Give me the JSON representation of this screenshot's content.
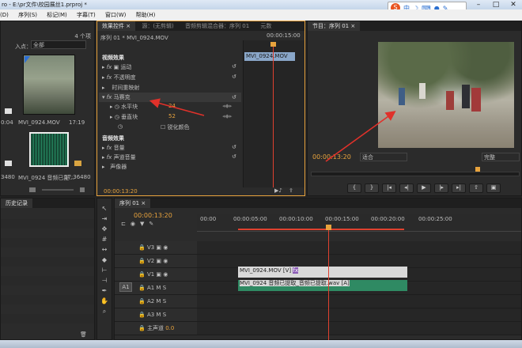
{
  "title_bar": {
    "title": "ro - E:\\pr文件\\校园展丝1.prproj *"
  },
  "menu": {
    "items": [
      "(D)",
      "序列(S)",
      "标记(M)",
      "字幕(T)",
      "窗口(W)",
      "帮助(H)"
    ]
  },
  "ime": {
    "label": "中"
  },
  "project_panel": {
    "item_count": "4 个项",
    "in_point_label": "入点：",
    "in_point_value": "全部",
    "clips": [
      {
        "name": "MVI_0924.MOV",
        "duration": "17:19",
        "left_time": "0:04"
      },
      {
        "name": "MVI_0924 音频已提...",
        "duration": "17:36480",
        "left_time": "3480"
      }
    ]
  },
  "effect_controls": {
    "tabs": [
      "效果控件 ×",
      "源：(无剪辑)",
      "音频剪辑混合器：序列 01",
      "元数"
    ],
    "sequence_label": "序列 01 * MVI_0924.MOV",
    "clip_label": "MVI_0924.MOV",
    "time_header": "00:00:15:00",
    "video_effects_header": "视频效果",
    "video_effects": [
      "运动",
      "不透明度",
      "时间重映射",
      "马赛克"
    ],
    "mosaic_params": [
      {
        "name": "水平块",
        "value": "24"
      },
      {
        "name": "垂直块",
        "value": "52"
      }
    ],
    "sharpen_label": "锐化颜色",
    "audio_effects_header": "音频效果",
    "audio_effects": [
      "音量",
      "声道音量",
      "声像器"
    ],
    "timecode": "00:00:13:20"
  },
  "program_monitor": {
    "tab": "节目：序列 01 ×",
    "timecode": "00:00:13:20",
    "fit_label": "适合",
    "quality_label": "完整"
  },
  "history_panel": {
    "tab": "历史记录"
  },
  "timeline": {
    "tab": "序列 01 ×",
    "timecode": "00:00:13:20",
    "ruler_labels": [
      "00:00",
      "00:00:05:00",
      "00:00:10:00",
      "00:00:15:00",
      "00:00:20:00",
      "00:00:25:00"
    ],
    "video_tracks": [
      "V3",
      "V2",
      "V1"
    ],
    "audio_tracks": [
      "A1",
      "A2",
      "A3"
    ],
    "source_patch": "A1",
    "master_label": "主声道",
    "master_value": "0.0",
    "video_clip": "MVI_0924.MOV [V]",
    "audio_clip": "MVI_0924 音频已提取_音频已提取.wav [A]"
  },
  "colors": {
    "accent": "#e8a33d",
    "playhead": "#e0412f",
    "audio_clip": "#2f8a63",
    "selected_panel": "#e8a33d"
  }
}
